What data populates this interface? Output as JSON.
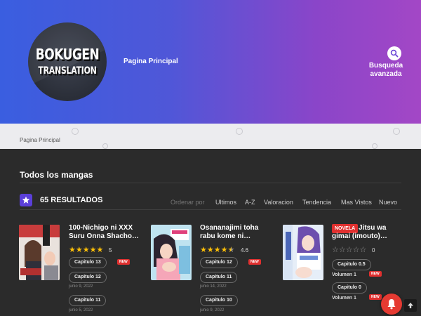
{
  "header": {
    "logo_line1": "BOKUGEN",
    "logo_line2": "TRANSLATION",
    "nav_home": "Pagina Principal",
    "advanced_search": "Busqueda avanzada",
    "gradient_start": "#3a5ee0",
    "gradient_end": "#a347c6"
  },
  "breadcrumb": {
    "home": "Pagina Principal"
  },
  "section": {
    "title": "Todos los mangas",
    "results": "65 RESULTADOS",
    "order_label": "Ordenar por",
    "sort_options": [
      "Ultimos",
      "A-Z",
      "Valoracion",
      "Tendencia",
      "Mas Vistos",
      "Nuevo"
    ]
  },
  "cards": [
    {
      "title": "100-Nichigo ni XXX Suru Onna Shacho…",
      "rating": "5",
      "stars_filled": 5,
      "chapters": [
        {
          "label": "Capitulo 13",
          "badge": "NEW",
          "date": ""
        },
        {
          "label": "Capitulo 12",
          "badge": "",
          "date": "junio 9, 2022"
        },
        {
          "label": "Capitulo 11",
          "badge": "",
          "date": "junio 5, 2022"
        }
      ]
    },
    {
      "title": "Osananajimi toha rabu kome ni…",
      "rating": "4.6",
      "stars_filled": 4.5,
      "chapters": [
        {
          "label": "Capitulo 12",
          "badge": "NEW",
          "date": ""
        },
        {
          "label": "Capitulo 11",
          "badge": "",
          "date": "junio 14, 2022"
        },
        {
          "label": "Capitulo 10",
          "badge": "",
          "date": "junio 9, 2022"
        }
      ]
    },
    {
      "title": "Jitsu wa gimai (imouto)…",
      "type_badge": "NOVELA",
      "rating": "0",
      "stars_filled": 0,
      "chapters": [
        {
          "label": "Capitulo 0.5",
          "badge": "NEW",
          "volume": "Volumen 1"
        },
        {
          "label": "Capitulo 0",
          "badge": "NEW",
          "volume": "Volumen 1"
        }
      ]
    }
  ],
  "colors": {
    "accent": "#5b3fd9",
    "new_badge": "#e0302f",
    "star": "#ffc107"
  }
}
